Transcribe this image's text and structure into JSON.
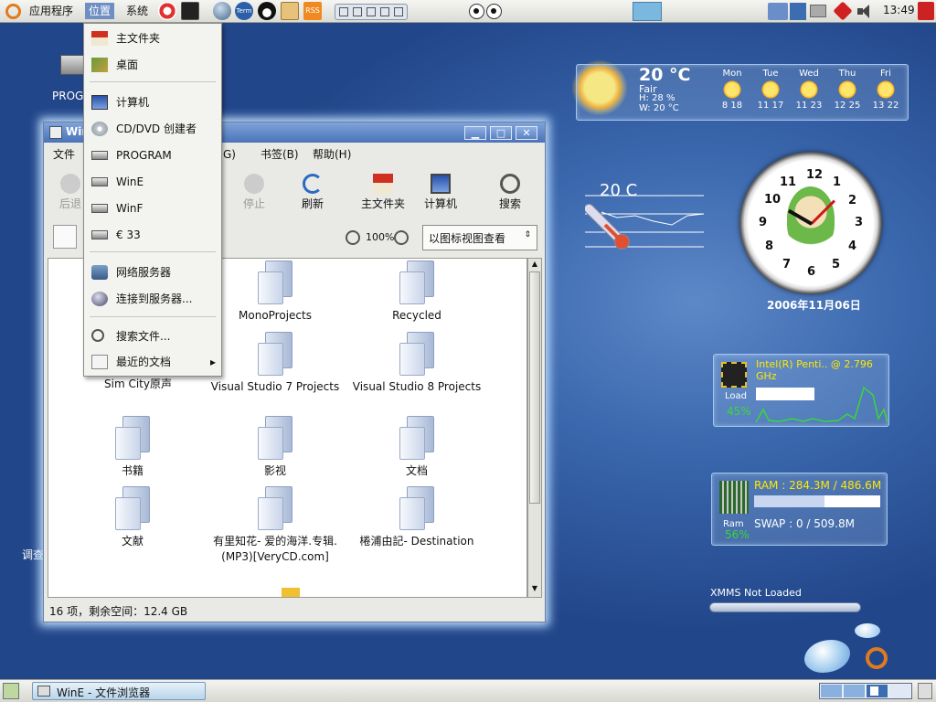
{
  "top_panel": {
    "menus": [
      "应用程序",
      "位置",
      "系统"
    ],
    "clock": "13:49",
    "launcher_labels": [
      "Term",
      "RSS"
    ]
  },
  "places_menu": {
    "items": [
      {
        "label": "主文件夹",
        "icon": "home-icon"
      },
      {
        "label": "桌面",
        "icon": "desktop-icon"
      },
      {
        "label": "计算机",
        "icon": "computer-icon"
      },
      {
        "label": "CD/DVD 创建者",
        "icon": "cd-icon"
      },
      {
        "label": "PROGRAM",
        "icon": "drive-icon"
      },
      {
        "label": "WinE",
        "icon": "drive-icon"
      },
      {
        "label": "WinF",
        "icon": "drive-icon"
      },
      {
        "label": "€ 33",
        "icon": "drive-icon"
      },
      {
        "label": "网络服务器",
        "icon": "network-icon"
      },
      {
        "label": "连接到服务器...",
        "icon": "globe-icon"
      },
      {
        "label": "搜索文件...",
        "icon": "search-icon"
      },
      {
        "label": "最近的文档",
        "icon": "recent-icon",
        "submenu_arrow": "▸"
      }
    ]
  },
  "window": {
    "title": "WinE",
    "menubar": [
      "文件",
      "G)",
      "书签(B)",
      "帮助(H)"
    ],
    "toolbar": {
      "back": "后退",
      "stop": "停止",
      "refresh": "刷新",
      "home": "主文件夹",
      "computer": "计算机",
      "search": "搜索"
    },
    "zoom": "100%",
    "view_mode": "以图标视图查看",
    "files": [
      {
        "name": "MonoProjects"
      },
      {
        "name": "Recycled"
      },
      {
        "name": "Sim City原声"
      },
      {
        "name": "Visual Studio 7 Projects"
      },
      {
        "name": "Visual Studio 8 Projects"
      },
      {
        "name": "书籍"
      },
      {
        "name": "影视"
      },
      {
        "name": "文档"
      },
      {
        "name": "文献"
      },
      {
        "name": "有里知花- 爱的海洋.专辑.(MP3)[VeryCD.com]"
      },
      {
        "name": "棬浦由記- Destination"
      }
    ],
    "status": "16 项，剩余空间：12.4 GB"
  },
  "desktop_icons": [
    {
      "label": "PROG"
    },
    {
      "label": "调查"
    }
  ],
  "weather": {
    "temp": "20 °C",
    "cond": "Fair",
    "humidity": "H: 28 %",
    "wind": "W: 20 °C",
    "days": [
      {
        "day": "Mon",
        "range": "8 18"
      },
      {
        "day": "Tue",
        "range": "11 17"
      },
      {
        "day": "Wed",
        "range": "11 23"
      },
      {
        "day": "Thu",
        "range": "12 25"
      },
      {
        "day": "Fri",
        "range": "13 22"
      }
    ]
  },
  "thermo": {
    "temp": "20 C"
  },
  "clock_widget": {
    "numbers": [
      "12",
      "1",
      "2",
      "3",
      "4",
      "5",
      "6",
      "7",
      "8",
      "9",
      "10",
      "11"
    ],
    "date": "2006年11月06日"
  },
  "cpu": {
    "name": "Intel(R) Penti.. @ 2.796",
    "unit": "GHz",
    "label": "Load",
    "percent": "45%"
  },
  "ram": {
    "ram": "RAM : 284.3M / 486.6M",
    "swap": "SWAP : 0 / 509.8M",
    "label": "Ram",
    "percent": "56%"
  },
  "xmms": {
    "status": "XMMS Not Loaded"
  },
  "taskbar": {
    "task": "WinE - 文件浏览器"
  }
}
